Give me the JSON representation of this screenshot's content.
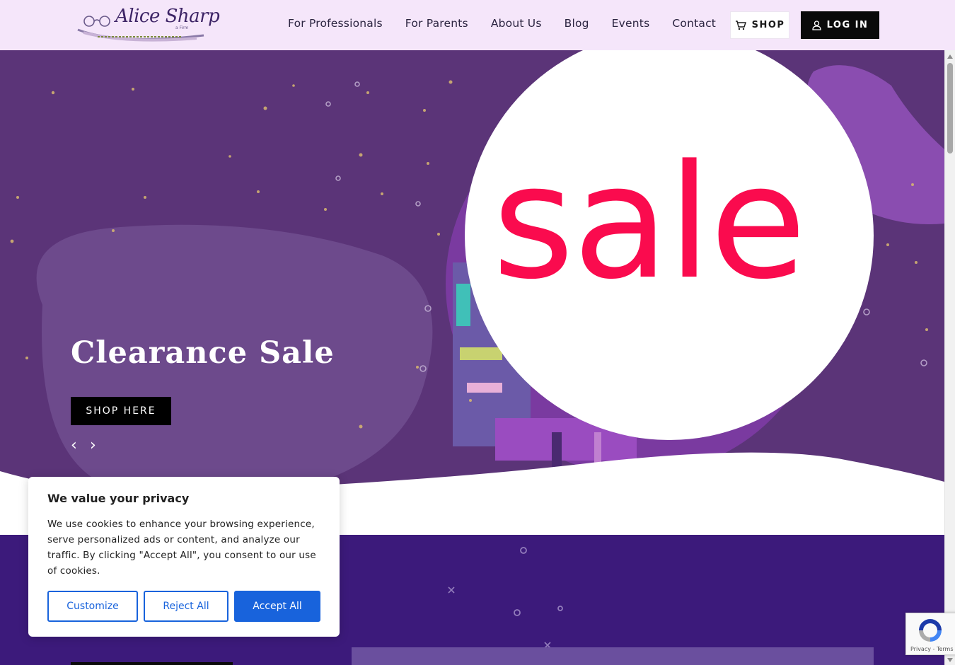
{
  "header": {
    "logo_text": "Alice Sharp",
    "logo_tagline": "a Firm",
    "nav": [
      "For Professionals",
      "For Parents",
      "About Us",
      "Blog",
      "Events",
      "Contact"
    ],
    "shop_label": "SHOP",
    "login_label": "LOG IN"
  },
  "hero": {
    "title": "Clearance Sale",
    "cta_label": "SHOP HERE",
    "badge_text": "sale",
    "prev_arrow": "‹",
    "next_arrow": "›"
  },
  "cookie_banner": {
    "title": "We value your privacy",
    "body": "We use cookies to enhance your browsing experience, serve personalized ads or content, and analyze our traffic. By clicking \"Accept All\", you consent to our use of cookies.",
    "customize_label": "Customize",
    "reject_label": "Reject All",
    "accept_label": "Accept All"
  },
  "recaptcha": {
    "links": "Privacy - Terms"
  },
  "colors": {
    "header_bg": "#f5e6fa",
    "hero_bg": "#5b3478",
    "band_bg": "#3c1a7b",
    "sale_red": "#fa0b4e",
    "accept_blue": "#1863dc"
  }
}
